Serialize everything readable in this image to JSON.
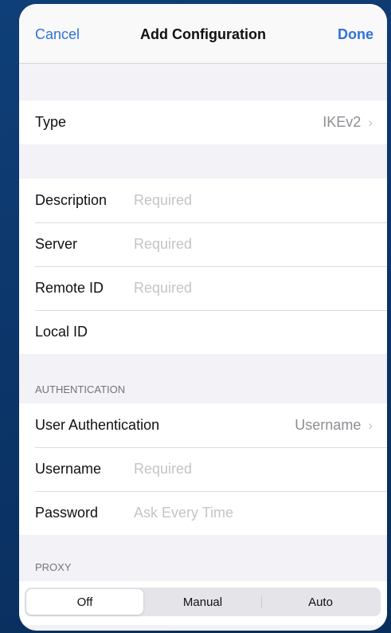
{
  "navbar": {
    "cancel_label": "Cancel",
    "title": "Add Configuration",
    "done_label": "Done"
  },
  "type_row": {
    "label": "Type",
    "value": "IKEv2"
  },
  "general": {
    "description": {
      "label": "Description",
      "placeholder": "Required"
    },
    "server": {
      "label": "Server",
      "placeholder": "Required"
    },
    "remote_id": {
      "label": "Remote ID",
      "placeholder": "Required"
    },
    "local_id": {
      "label": "Local ID",
      "placeholder": ""
    }
  },
  "authentication": {
    "header": "AUTHENTICATION",
    "user_auth": {
      "label": "User Authentication",
      "value": "Username"
    },
    "username": {
      "label": "Username",
      "placeholder": "Required"
    },
    "password": {
      "label": "Password",
      "placeholder": "Ask Every Time"
    }
  },
  "proxy": {
    "header": "PROXY",
    "options": [
      "Off",
      "Manual",
      "Auto"
    ],
    "selected": "Off"
  },
  "colors": {
    "accent": "#2f73d9",
    "background": "#0f3f78"
  }
}
